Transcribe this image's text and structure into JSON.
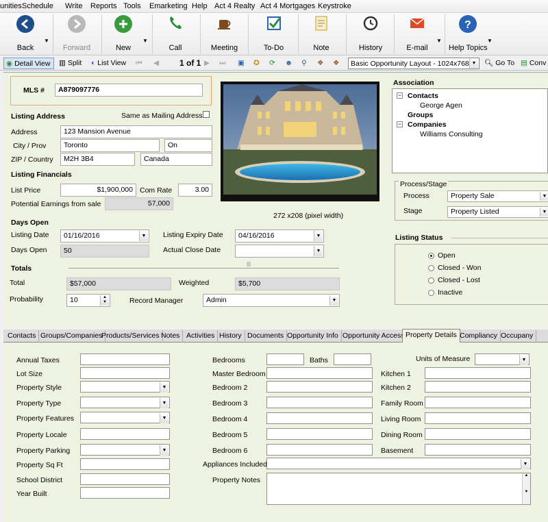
{
  "menu": [
    "unities",
    "Schedule",
    "Write",
    "Reports",
    "Tools",
    "Emarketing",
    "Help",
    "Act 4 Realty",
    "Act 4 Mortgages",
    "Keystroke"
  ],
  "toolbar": {
    "back": "Back",
    "forward": "Forward",
    "new": "New",
    "call": "Call",
    "meeting": "Meeting",
    "todo": "To-Do",
    "note": "Note",
    "history": "History",
    "email": "E-mail",
    "help": "Help Topics"
  },
  "viewbar": {
    "detail_view": "Detail View",
    "split": "Split",
    "list_view": "List View",
    "record_counter": "1 of 1",
    "layout": "Basic Opportunity Layout - 1024x768",
    "go_to": "Go To",
    "conv": "Conv"
  },
  "record": {
    "mls_label": "MLS #",
    "mls": "A879097776",
    "listing_address_header": "Listing Address",
    "same_as_mailing": "Same as Mailing Address",
    "address_label": "Address",
    "address": "123 Mansion Avenue",
    "city_prov_label": "City / Prov",
    "city": "Toronto",
    "prov": "On",
    "zip_country_label": "ZIP / Country",
    "zip": "M2H 3B4",
    "country": "Canada",
    "financials_header": "Listing Financials",
    "list_price_label": "List Price",
    "list_price": "$1,900,000",
    "com_rate_label": "Com Rate",
    "com_rate": "3.00",
    "potential_label": "Potential Earnings from sale",
    "potential": "57,000",
    "days_open_header": "Days Open",
    "listing_date_label": "Listing Date",
    "listing_date": "01/16/2016",
    "expiry_label": "Listing Expiry Date",
    "expiry": "04/16/2016",
    "days_open_label": "Days Open",
    "days_open": "50",
    "close_date_label": "Actual Close Date",
    "close_date": "",
    "totals_header": "Totals",
    "total_label": "Total",
    "total": "$57,000",
    "weighted_label": "Weighted",
    "weighted": "$5,700",
    "probability_label": "Probability",
    "probability": "10",
    "record_manager_label": "Record Manager",
    "record_manager": "Admin",
    "photo_caption": "272 x208 (pixel width)"
  },
  "association": {
    "header": "Association",
    "contacts_label": "Contacts",
    "contact": "George Agen",
    "groups_label": "Groups",
    "companies_label": "Companies",
    "company": "Williams Consulting"
  },
  "process": {
    "header": "Process/Stage",
    "process_label": "Process",
    "process": "Property Sale",
    "stage_label": "Stage",
    "stage": "Property Listed"
  },
  "status": {
    "header": "Listing Status",
    "options": [
      "Open",
      "Closed - Won",
      "Closed - Lost",
      "Inactive"
    ],
    "selected": "Open"
  },
  "tabs": [
    "Contacts",
    "Groups/Companies",
    "Products/Services",
    "Notes",
    "Activities",
    "History",
    "Documents",
    "Opportunity Info",
    "Opportunity Access",
    "Property Details",
    "Compliancy",
    "Occupany"
  ],
  "active_tab": "Property Details",
  "details": {
    "col1": [
      "Annual Taxes",
      "Lot Size",
      "Property Style",
      "Property Type",
      "Property Features",
      "Property Locale",
      "Property Parking",
      "Property Sq Ft",
      "School District",
      "Year Built"
    ],
    "col2": [
      "Bedrooms",
      "Master Bedroom",
      "Bedroom 2",
      "Bedroom 3",
      "Bedroom 4",
      "Bedroom 5",
      "Bedroom 6",
      "Appliances Included",
      "Property Notes"
    ],
    "baths": "Baths",
    "units": "Units of Measure",
    "col3": [
      "Kitchen 1",
      "Kitchen 2",
      "Family Room",
      "Living Room",
      "Dining Room",
      "Basement"
    ]
  },
  "colors": {
    "panel": "#eef2e1",
    "call_green": "#2a8f3b",
    "help_blue": "#2a63b5",
    "email_red": "#e04a24"
  }
}
